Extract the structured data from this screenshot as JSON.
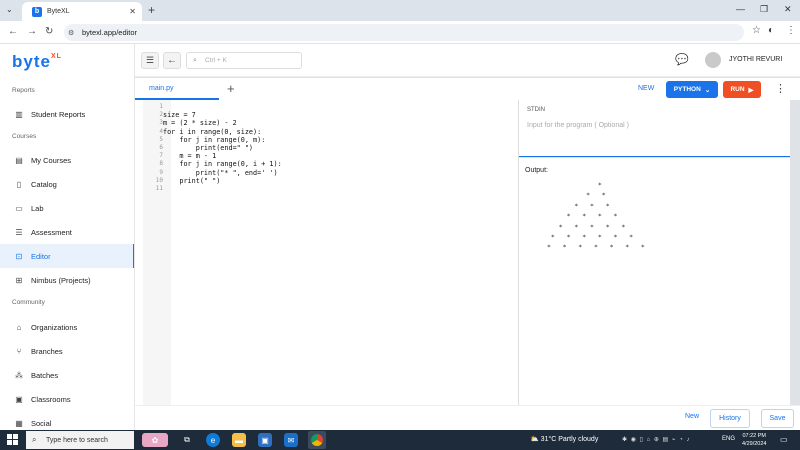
{
  "browser": {
    "tab_title": "ByteXL",
    "tab_favicon": "b",
    "url": "bytexl.app/editor"
  },
  "app": {
    "logo": "byte",
    "logo_sup": "XL",
    "search_placeholder": "Ctrl + K",
    "username": "JYOTHI REVURI"
  },
  "sidebar": {
    "sections": {
      "reports": "Reports",
      "courses": "Courses",
      "community": "Community"
    },
    "items": [
      {
        "label": "Student Reports",
        "icon": "bar-chart-icon"
      },
      {
        "label": "My Courses",
        "icon": "book-icon"
      },
      {
        "label": "Catalog",
        "icon": "catalog-icon"
      },
      {
        "label": "Lab",
        "icon": "laptop-icon"
      },
      {
        "label": "Assessment",
        "icon": "assessment-icon"
      },
      {
        "label": "Editor",
        "icon": "editor-icon"
      },
      {
        "label": "Nimbus (Projects)",
        "icon": "grid-icon"
      },
      {
        "label": "Organizations",
        "icon": "building-icon"
      },
      {
        "label": "Branches",
        "icon": "branches-icon"
      },
      {
        "label": "Batches",
        "icon": "batches-icon"
      },
      {
        "label": "Classrooms",
        "icon": "classroom-icon"
      },
      {
        "label": "Social",
        "icon": "social-icon"
      }
    ]
  },
  "editor": {
    "file_tab": "main.py",
    "new_label": "NEW",
    "language": "PYTHON",
    "run_label": "RUN",
    "lines": [
      "",
      "size = 7",
      "m = (2 * size) - 2",
      "for i in range(0, size):",
      "    for j in range(0, m):",
      "        print(end=\" \")",
      "    m = m - 1",
      "    for j in range(0, i + 1):",
      "        print(\"* \", end=' ')",
      "    print(\" \")",
      ""
    ],
    "line_numbers": [
      "1",
      "2",
      "3",
      "4",
      "5",
      "6",
      "7",
      "8",
      "9",
      "10",
      "11"
    ]
  },
  "io": {
    "stdin_label": "STDIN",
    "stdin_placeholder": "Input for the program ( Optional )",
    "output_label": "Output:",
    "output_text": "             *\n          *   *\n       *   *   *\n     *   *   *   *\n   *   *   *   *   *\n *   *   *   *   *   *\n*   *   *   *   *   *   *"
  },
  "bottom": {
    "new_label": "New",
    "history_label": "History",
    "save_label": "Save"
  },
  "taskbar": {
    "search_placeholder": "Type here to search",
    "weather": "31°C  Partly cloudy",
    "language": "ENG",
    "time": "07:22 PM",
    "date": "4/29/2024"
  }
}
